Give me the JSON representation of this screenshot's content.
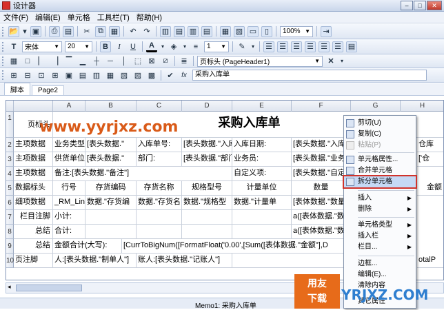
{
  "window": {
    "title": "设计器"
  },
  "menu": [
    "文件(F)",
    "编辑(E)",
    "单元格",
    "工具栏(T)",
    "帮助(H)"
  ],
  "toolbar1": {
    "icons": [
      "open-icon",
      "save-icon",
      "print-icon",
      "preview-icon",
      "cut-icon",
      "copy-icon",
      "paste-icon",
      "undo-icon",
      "redo-icon",
      "insert-row-icon",
      "delete-row-icon",
      "insert-col-icon",
      "delete-col-icon",
      "table-icon",
      "chart-icon",
      "merge-icon",
      "split-icon",
      "zoom-icon",
      "exit-icon"
    ],
    "zoom": "100%"
  },
  "toolbar2": {
    "font": "宋体",
    "size": "20",
    "bold": "B",
    "italic": "I",
    "underline": "U",
    "font_color": "A",
    "line_width": "1"
  },
  "toolbar3": {
    "section_select": "页标头 (PageHeader1)",
    "formula_prefix": "fx",
    "formula_value": "采购入库单"
  },
  "tabs": [
    "脚本",
    "Page2"
  ],
  "columns": [
    "A",
    "B",
    "C",
    "D",
    "E",
    "F",
    "G",
    "H"
  ],
  "rows": [
    "1",
    "2",
    "3",
    "4",
    "5",
    "6",
    "7",
    "8",
    "9",
    "10"
  ],
  "cells": {
    "r1a": "页标头",
    "r1title": "采购入库单",
    "r2a": "主项数据",
    "r2b": "业务类型:",
    "r2c": "[表头数据.\"",
    "r2d": "入库单号:",
    "r2e": "[表头数据.\"入库",
    "r2f": "入库日期:",
    "r2g": "[表头数据.\"入库日期\"",
    "r3a": "主项数据",
    "r3b": "供货单位:",
    "r3c": "[表头数据.\"",
    "r3d": "部门:",
    "r3e": "[表头数据.\"部门\"]",
    "r3f": "业务员:",
    "r3g": "[表头数据.\"业务员\"]",
    "r4a": "主项数据",
    "r4b": "备注:[表头数据.\"备注\"]",
    "r4f": "自定义项:",
    "r4g": "[表头数据.\"自定义项",
    "r5a": "数据标头",
    "r5b": "行号",
    "r5c": "存货编码",
    "r5d": "存货名称",
    "r5e": "规格型号",
    "r5f": "计量单位",
    "r5g": "数量",
    "r5h": "金额",
    "r6a": "细项数据",
    "r6b": "_RM_Line",
    "r6c": "数据.\"存货编",
    "r6d": "数据.\"存货名",
    "r6e": "数据.\"规格型",
    "r6f": "数据.\"计量单",
    "r6g": "[表体数据.\"数量",
    "r7a": "栏目注脚",
    "r7b": "小计:",
    "r7g": "a([表体数据.\"数量",
    "r8a": "总结",
    "r8b": "合计:",
    "r8g": "a([表体数据.\"数量",
    "r9a": "总结",
    "r9b": "金额合计(大写):",
    "r9c": "[CurrToBigNum([FormatFloat('0.00',[Sum([表体数据.\"金额\"],D",
    "r10a": "页注脚",
    "r10b": "人:[表头数据.\"制单人\"]",
    "r10c": "账人:[表头数据.\"记账人\"]",
    "r10h": "otalP"
  },
  "context_menu": [
    {
      "label": "剪切(U)",
      "icon": "cut-icon",
      "enabled": true
    },
    {
      "label": "复制(C)",
      "icon": "copy-icon",
      "enabled": true
    },
    {
      "label": "粘贴(P)",
      "icon": "paste-icon",
      "enabled": false
    },
    {
      "label": "单元格属性...",
      "icon": "cell-props-icon",
      "enabled": true
    },
    {
      "label": "合并单元格",
      "icon": "merge-icon",
      "enabled": true
    },
    {
      "label": "拆分单元格",
      "icon": "split-icon",
      "enabled": true,
      "highlighted": true
    },
    {
      "label": "插入",
      "submenu": true
    },
    {
      "label": "删除",
      "submenu": true
    },
    {
      "label": "单元格类型",
      "submenu": true
    },
    {
      "label": "插入栏",
      "submenu": true
    },
    {
      "label": "栏目...",
      "submenu": true
    },
    {
      "label": "边框..."
    },
    {
      "label": "编辑(E)..."
    },
    {
      "label": "清除内容"
    },
    {
      "label": "其它属性"
    }
  ],
  "side_peek": {
    "r2": "仓库",
    "r3": "['仓"
  },
  "status": {
    "text": "Memo1: 采购入库单"
  },
  "watermarks": {
    "site": "www.yyrjxz.com",
    "logo_top": "用友",
    "logo_bottom": "下载",
    "brand": "YRJXZ.COM"
  }
}
